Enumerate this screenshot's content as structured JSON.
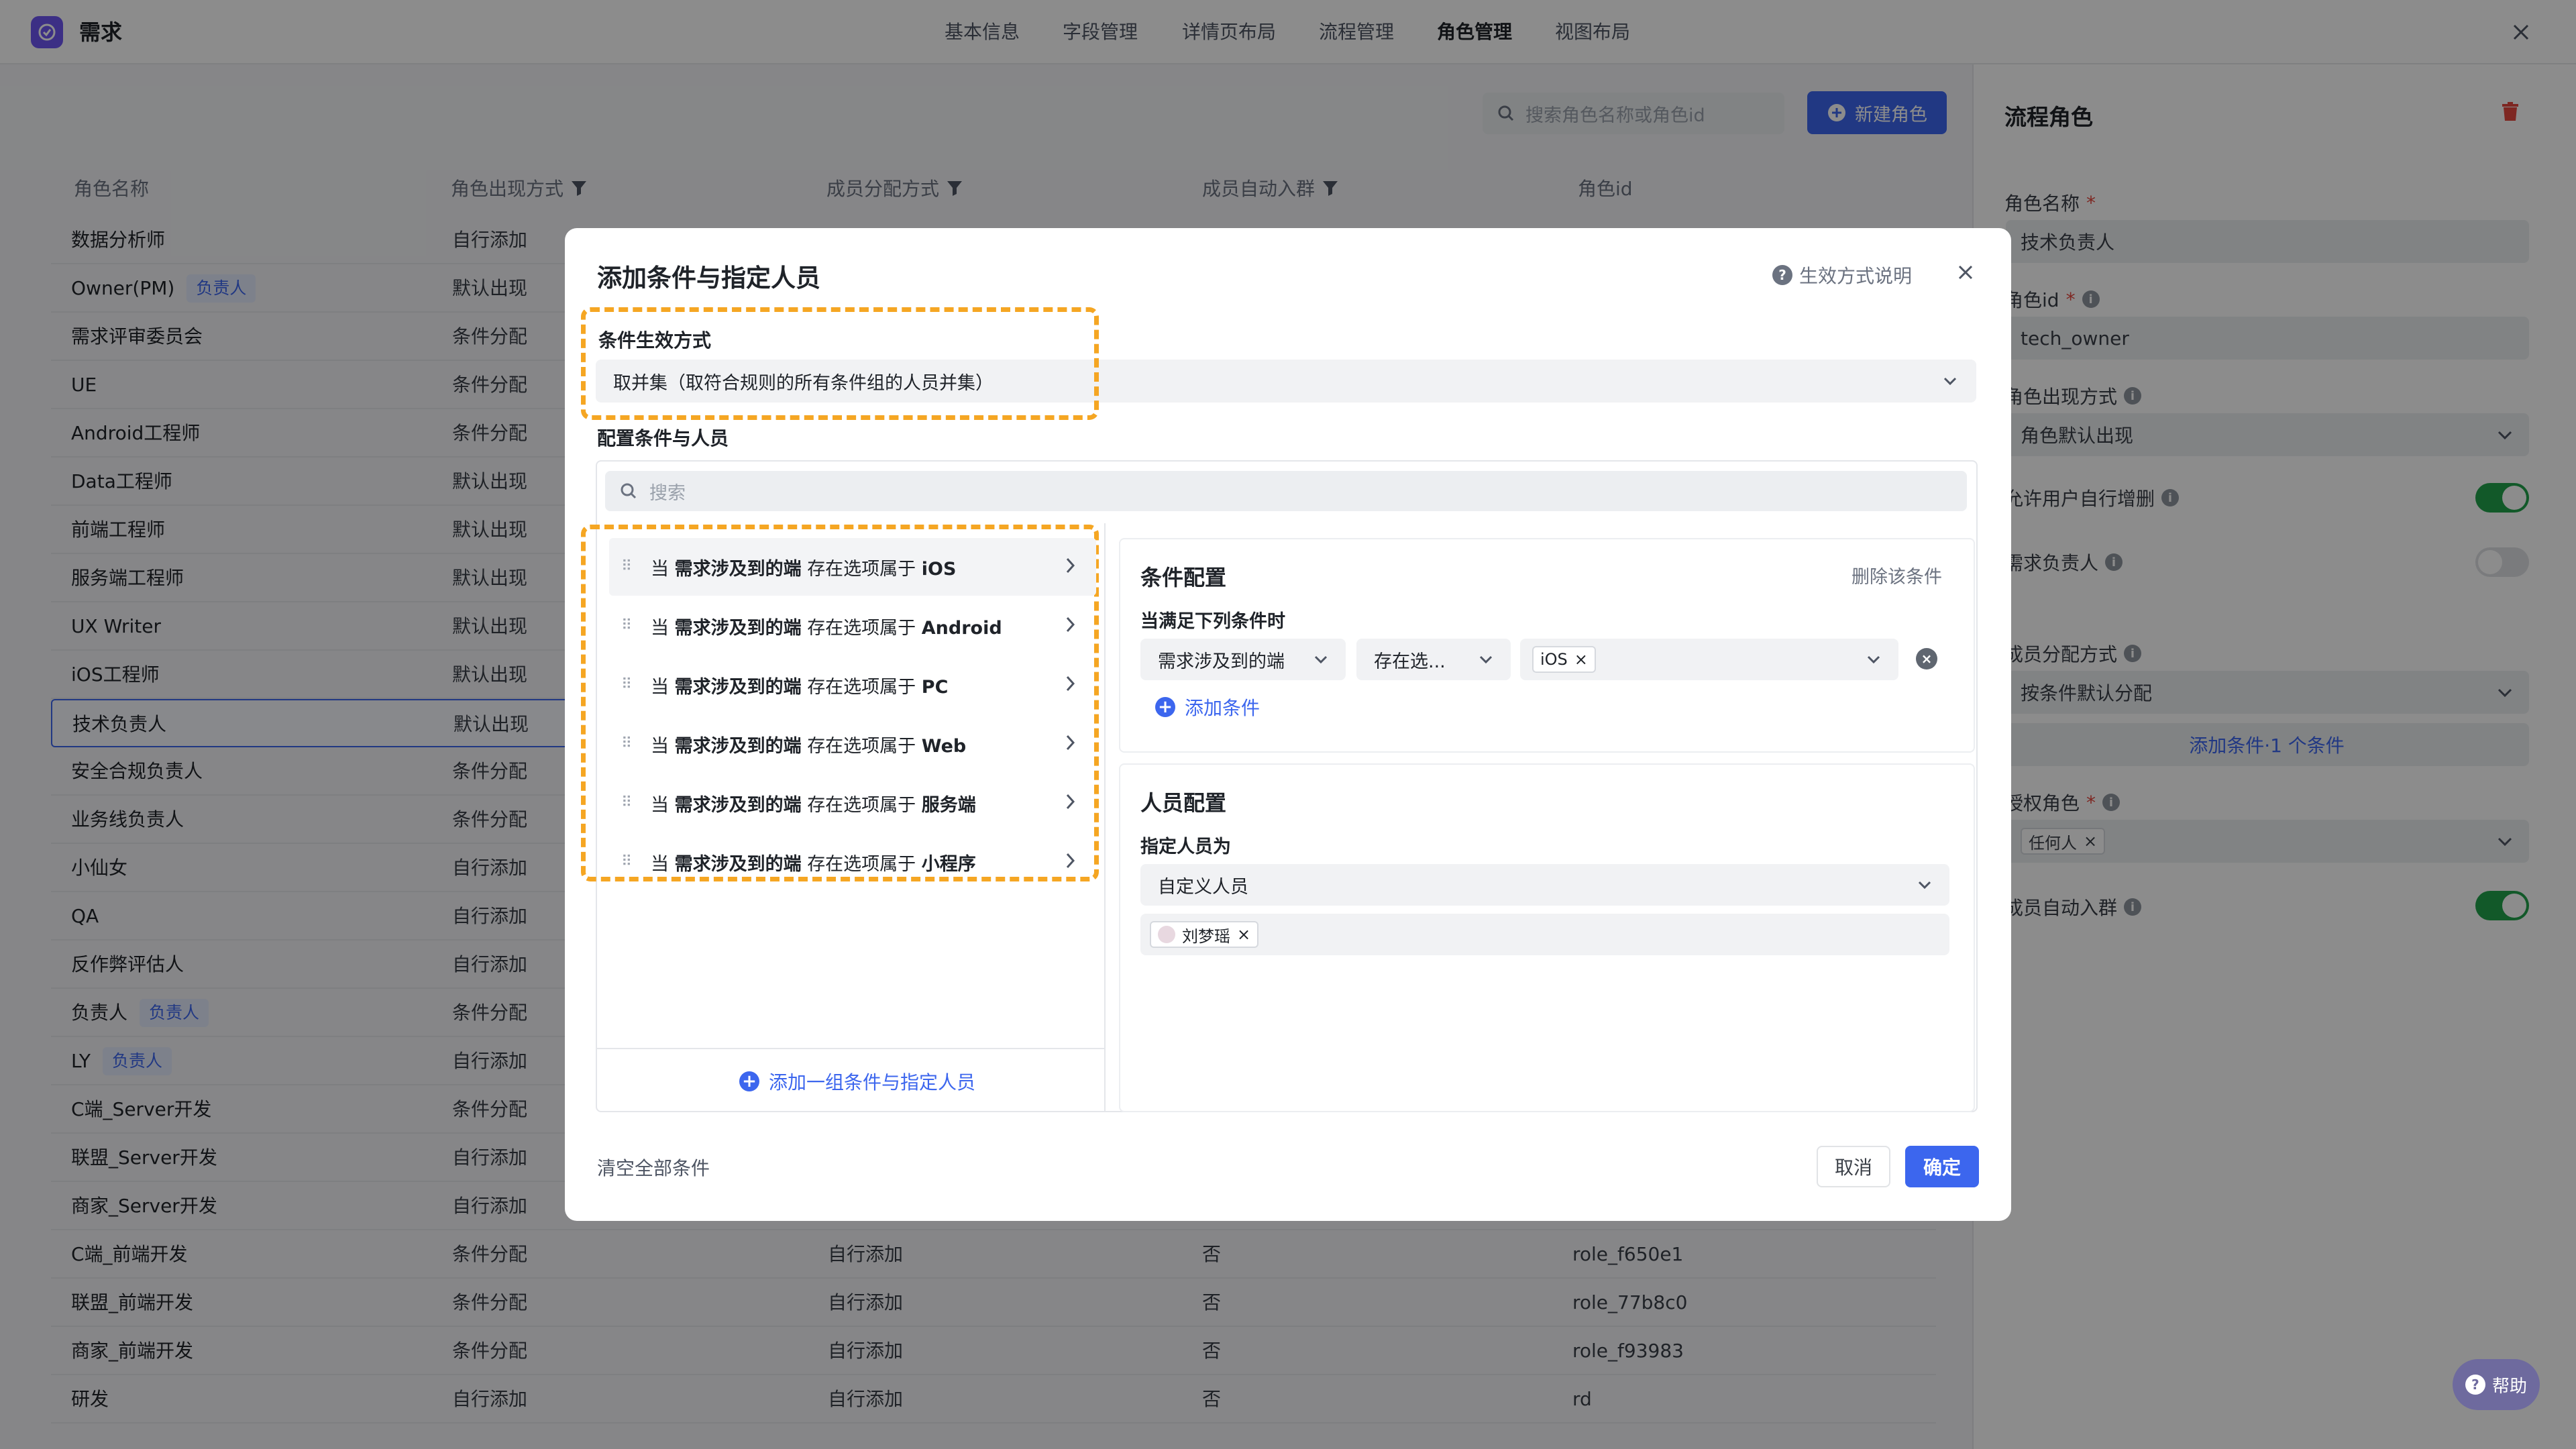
{
  "app": {
    "title": "需求"
  },
  "nav": [
    "基本信息",
    "字段管理",
    "详情页布局",
    "流程管理",
    "角色管理",
    "视图布局"
  ],
  "toolbar": {
    "search_placeholder": "搜索角色名称或角色id",
    "new_role": "新建角色"
  },
  "table": {
    "headers": [
      "角色名称",
      "角色出现方式",
      "成员分配方式",
      "成员自动入群",
      "角色id"
    ],
    "rows": [
      {
        "name": "数据分析师",
        "mode": "自行添加"
      },
      {
        "name": "Owner(PM)",
        "badge": "负责人",
        "mode": "默认出现"
      },
      {
        "name": "需求评审委员会",
        "mode": "条件分配"
      },
      {
        "name": "UE",
        "mode": "条件分配"
      },
      {
        "name": "Android工程师",
        "mode": "条件分配"
      },
      {
        "name": "Data工程师",
        "mode": "默认出现"
      },
      {
        "name": "前端工程师",
        "mode": "默认出现"
      },
      {
        "name": "服务端工程师",
        "mode": "默认出现"
      },
      {
        "name": "UX Writer",
        "mode": "默认出现"
      },
      {
        "name": "iOS工程师",
        "mode": "默认出现"
      },
      {
        "name": "技术负责人",
        "mode": "默认出现"
      },
      {
        "name": "安全合规负责人",
        "mode": "条件分配"
      },
      {
        "name": "业务线负责人",
        "mode": "条件分配"
      },
      {
        "name": "小仙女",
        "mode": "自行添加"
      },
      {
        "name": "QA",
        "mode": "自行添加"
      },
      {
        "name": "反作弊评估人",
        "mode": "自行添加"
      },
      {
        "name": "负责人",
        "badge": "负责人",
        "mode": "条件分配"
      },
      {
        "name": "LY",
        "badge": "负责人",
        "mode": "自行添加"
      },
      {
        "name": "C端_Server开发",
        "mode": "条件分配"
      },
      {
        "name": "联盟_Server开发",
        "mode": "自行添加"
      },
      {
        "name": "商家_Server开发",
        "mode": "自行添加"
      },
      {
        "name": "C端_前端开发",
        "mode": "条件分配",
        "assign": "自行添加",
        "auto": "否",
        "id": "role_f650e1"
      },
      {
        "name": "联盟_前端开发",
        "mode": "条件分配",
        "assign": "自行添加",
        "auto": "否",
        "id": "role_77b8c0"
      },
      {
        "name": "商家_前端开发",
        "mode": "条件分配",
        "assign": "自行添加",
        "auto": "否",
        "id": "role_f93983"
      },
      {
        "name": "研发",
        "mode": "自行添加",
        "assign": "自行添加",
        "auto": "否",
        "id": "rd"
      }
    ]
  },
  "side": {
    "title": "流程角色",
    "name_label": "角色名称",
    "name_value": "技术负责人",
    "id_label": "角色id",
    "id_value": "tech_owner",
    "appear_label": "角色出现方式",
    "appear_value": "角色默认出现",
    "allow_label": "允许用户自行增删",
    "owner_label": "需求负责人",
    "assign_label": "成员分配方式",
    "assign_value": "按条件默认分配",
    "add_condition": "添加条件·1 个条件",
    "auth_label": "授权角色",
    "auth_tag": "任何人",
    "autojoin_label": "成员自动入群"
  },
  "modal": {
    "title": "添加条件与指定人员",
    "help": "生效方式说明",
    "mode_label": "条件生效方式",
    "mode_value": "取并集（取符合规则的所有条件组的人员并集）",
    "config_label": "配置条件与人员",
    "search_placeholder": "搜索",
    "conditions": [
      {
        "prefix": "当",
        "field": "需求涉及到的端",
        "op": "存在选项属于",
        "value": "iOS"
      },
      {
        "prefix": "当",
        "field": "需求涉及到的端",
        "op": "存在选项属于",
        "value": "Android"
      },
      {
        "prefix": "当",
        "field": "需求涉及到的端",
        "op": "存在选项属于",
        "value": "PC"
      },
      {
        "prefix": "当",
        "field": "需求涉及到的端",
        "op": "存在选项属于",
        "value": "Web"
      },
      {
        "prefix": "当",
        "field": "需求涉及到的端",
        "op": "存在选项属于",
        "value": "服务端"
      },
      {
        "prefix": "当",
        "field": "需求涉及到的端",
        "op": "存在选项属于",
        "value": "小程序"
      }
    ],
    "add_group": "添加一组条件与指定人员",
    "cond_config": {
      "title": "条件配置",
      "delete": "删除该条件",
      "when_label": "当满足下列条件时",
      "field": "需求涉及到的端",
      "op": "存在选...",
      "value_tag": "iOS",
      "add": "添加条件"
    },
    "person_config": {
      "title": "人员配置",
      "assign_label": "指定人员为",
      "assign_value": "自定义人员",
      "person": "刘梦瑶"
    },
    "clear_all": "清空全部条件",
    "cancel": "取消",
    "ok": "确定"
  },
  "help_float": "帮助",
  "colors": {
    "primary": "#3c66ee",
    "highlight": "#f5a623",
    "toggle_on": "#21a34b",
    "danger": "#e5483e"
  }
}
